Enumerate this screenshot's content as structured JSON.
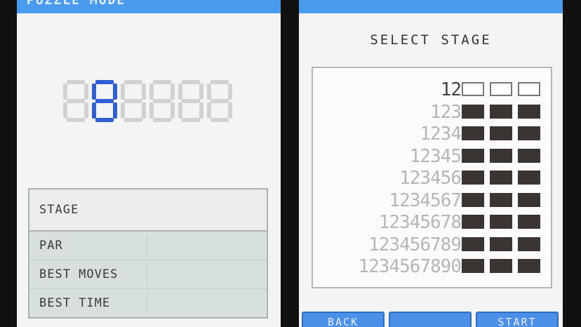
{
  "left_screen": {
    "title": "PUZZLE MODE",
    "display": {
      "digit_count": 6,
      "active_digit_index": 1
    },
    "info": {
      "stage_label": "STAGE",
      "stats": [
        {
          "label": "PAR",
          "value": ""
        },
        {
          "label": "BEST MOVES",
          "value": ""
        },
        {
          "label": "BEST TIME",
          "value": ""
        }
      ]
    }
  },
  "right_screen": {
    "title": "SELECT STAGE",
    "levels": [
      {
        "label": "12",
        "current": true,
        "boxes": [
          "empty",
          "empty",
          "empty"
        ]
      },
      {
        "label": "123",
        "current": false,
        "boxes": [
          "locked",
          "locked",
          "locked"
        ]
      },
      {
        "label": "1234",
        "current": false,
        "boxes": [
          "locked",
          "locked",
          "locked"
        ]
      },
      {
        "label": "12345",
        "current": false,
        "boxes": [
          "locked",
          "locked",
          "locked"
        ]
      },
      {
        "label": "123456",
        "current": false,
        "boxes": [
          "locked",
          "locked",
          "locked"
        ]
      },
      {
        "label": "1234567",
        "current": false,
        "boxes": [
          "locked",
          "locked",
          "locked"
        ]
      },
      {
        "label": "12345678",
        "current": false,
        "boxes": [
          "locked",
          "locked",
          "locked"
        ]
      },
      {
        "label": "123456789",
        "current": false,
        "boxes": [
          "locked",
          "locked",
          "locked"
        ]
      },
      {
        "label": "1234567890",
        "current": false,
        "boxes": [
          "locked",
          "locked",
          "locked"
        ]
      }
    ],
    "buttons": {
      "back": "BACK",
      "middle": "",
      "start": "START"
    }
  },
  "colors": {
    "accent": "#4a9bf0",
    "active_segment": "#2f5fd6",
    "inactive_segment": "#d2d2d2",
    "locked_box": "#3a3432"
  }
}
